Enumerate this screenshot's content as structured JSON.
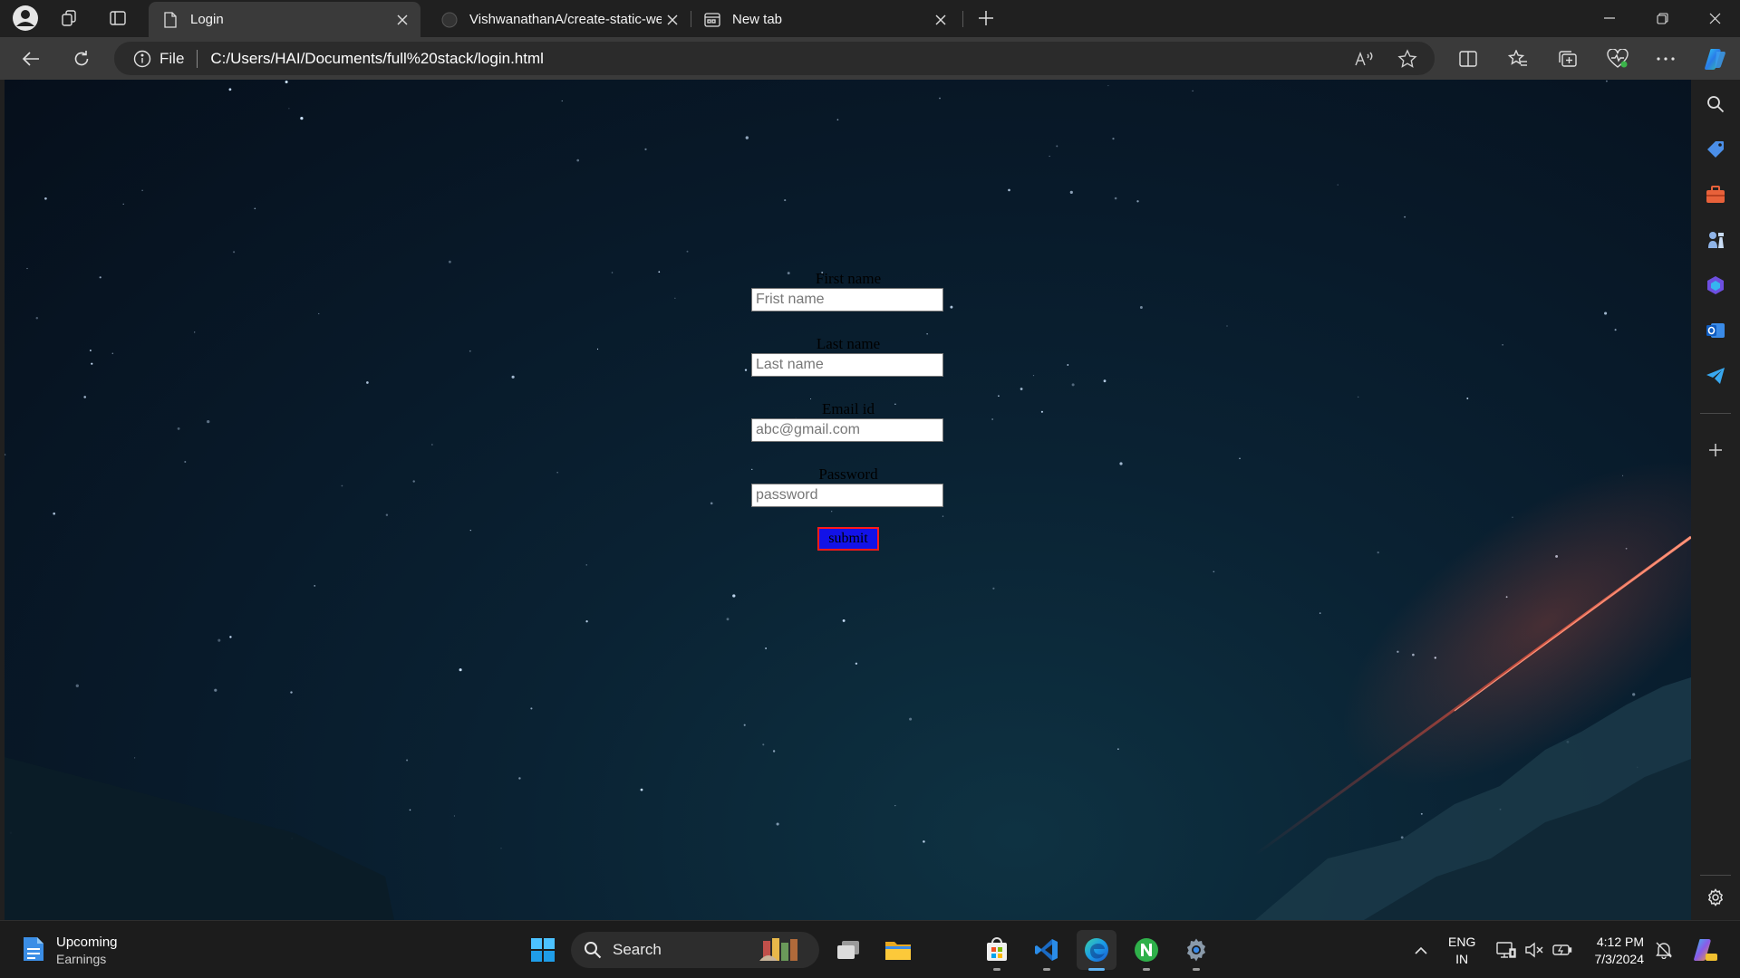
{
  "browser": {
    "tabs": [
      {
        "title": "Login",
        "active": true
      },
      {
        "title": "VishwanathanA/create-static-wel",
        "active": false
      },
      {
        "title": "New tab",
        "active": false
      }
    ],
    "address": {
      "scheme_label": "File",
      "url": "C:/Users/HAI/Documents/full%20stack/login.html"
    }
  },
  "login_form": {
    "fields": [
      {
        "label": "First name",
        "placeholder": "Frist name",
        "type": "text"
      },
      {
        "label": "Last name",
        "placeholder": "Last name",
        "type": "text"
      },
      {
        "label": "Email id",
        "placeholder": "abc@gmail.com",
        "type": "email"
      },
      {
        "label": "Password",
        "placeholder": "password",
        "type": "password"
      }
    ],
    "submit_label": "submit",
    "colors": {
      "submit_bg": "#1212e8",
      "submit_border": "#ff1a1a",
      "label_text": "#000000"
    }
  },
  "taskbar": {
    "widget": {
      "title": "Upcoming",
      "subtitle": "Earnings"
    },
    "search_label": "Search",
    "apps": [
      "start-icon",
      "task-view-icon",
      "file-explorer-icon",
      "store-icon",
      "vscode-icon",
      "edge-icon",
      "notepad-n-icon",
      "settings-icon"
    ],
    "language": {
      "line1": "ENG",
      "line2": "IN"
    },
    "clock": {
      "time": "4:12 PM",
      "date": "7/3/2024"
    }
  },
  "theme": {
    "accent": "#5fb2f2",
    "window_bg": "#202020",
    "toolbar_bg": "#3a3a3a"
  }
}
